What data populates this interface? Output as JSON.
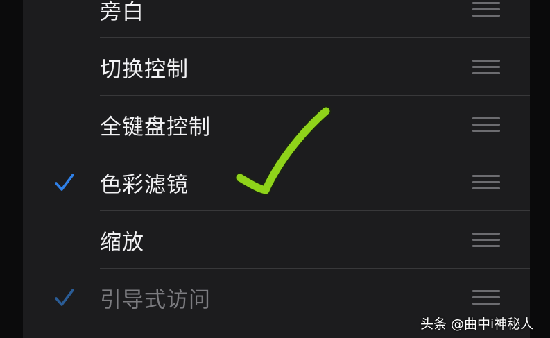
{
  "list": {
    "items": [
      {
        "label": "旁白",
        "checked": false,
        "dimmed": false
      },
      {
        "label": "切换控制",
        "checked": false,
        "dimmed": false
      },
      {
        "label": "全键盘控制",
        "checked": false,
        "dimmed": false
      },
      {
        "label": "色彩滤镜",
        "checked": true,
        "dimmed": false
      },
      {
        "label": "缩放",
        "checked": false,
        "dimmed": false
      },
      {
        "label": "引导式访问",
        "checked": true,
        "dimmed": true
      }
    ]
  },
  "colors": {
    "checkmark": "#2f80e8",
    "annotation": "#8fd31a"
  },
  "icons": {
    "check": "checkmark-icon",
    "reorder": "reorder-handle-icon",
    "annotation": "hand-drawn-checkmark"
  },
  "watermark": {
    "brand": "头条",
    "handle": "@曲中i神秘人"
  }
}
